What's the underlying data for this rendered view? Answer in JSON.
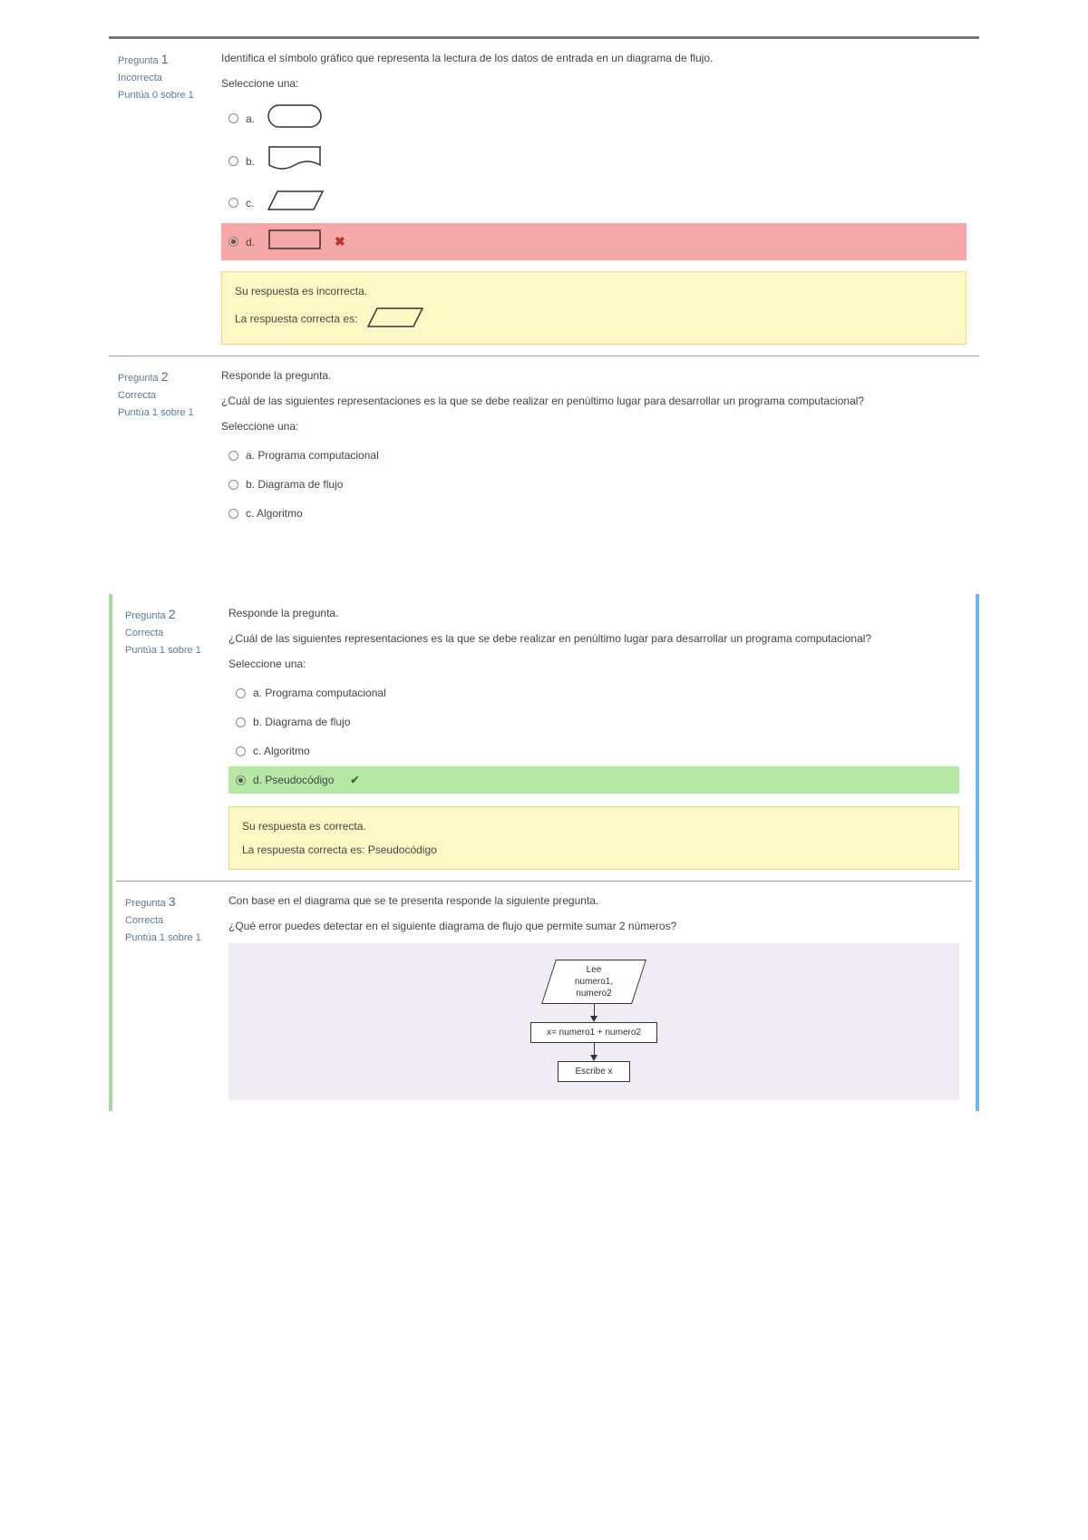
{
  "section1": {
    "q1": {
      "label": "Pregunta",
      "num": "1",
      "status": "Incorrecta",
      "score": "Puntúa 0 sobre 1",
      "text": "Identifica el símbolo gráfico que representa la lectura de los datos de entrada en un diagrama de flujo.",
      "select": "Seleccione una:",
      "opt_a": "a.",
      "opt_b": "b.",
      "opt_c": "c.",
      "opt_d": "d.",
      "fb_wrong": "Su respuesta es incorrecta.",
      "fb_correct": "La respuesta correcta es:"
    },
    "q2": {
      "label": "Pregunta",
      "num": "2",
      "status": "Correcta",
      "score": "Puntúa 1 sobre 1",
      "title": "Responde la pregunta.",
      "text": "¿Cuál de las siguientes representaciones es la que se debe realizar en penúltimo lugar para desarrollar un programa computacional?",
      "select": "Seleccione una:",
      "opt_a": "a. Programa computacional",
      "opt_b": "b. Diagrama de flujo",
      "opt_c": "c. Algoritmo"
    }
  },
  "section2": {
    "q2": {
      "label": "Pregunta",
      "num": "2",
      "status": "Correcta",
      "score": "Puntúa 1 sobre 1",
      "title": "Responde la pregunta.",
      "text": "¿Cuál de las siguientes representaciones es la que se debe realizar en penúltimo lugar para desarrollar un programa computacional?",
      "select": "Seleccione una:",
      "opt_a": "a. Programa computacional",
      "opt_b": "b. Diagrama de flujo",
      "opt_c": "c. Algoritmo",
      "opt_d": "d. Pseudocódigo",
      "fb_right": "Su respuesta es correcta.",
      "fb_correct": "La respuesta correcta es: Pseudocódigo"
    },
    "q3": {
      "label": "Pregunta",
      "num": "3",
      "status": "Correcta",
      "score": "Puntúa 1 sobre 1",
      "title": "Con base en el diagrama que se te presenta responde la siguiente pregunta.",
      "text": "¿Qué error puedes detectar en el siguiente diagrama de flujo que permite sumar 2 números?",
      "diag_read_l1": "Lee",
      "diag_read_l2": "numero1,",
      "diag_read_l3": "numero2",
      "diag_proc": "x= numero1 + numero2",
      "diag_out": "Escribe x"
    }
  }
}
